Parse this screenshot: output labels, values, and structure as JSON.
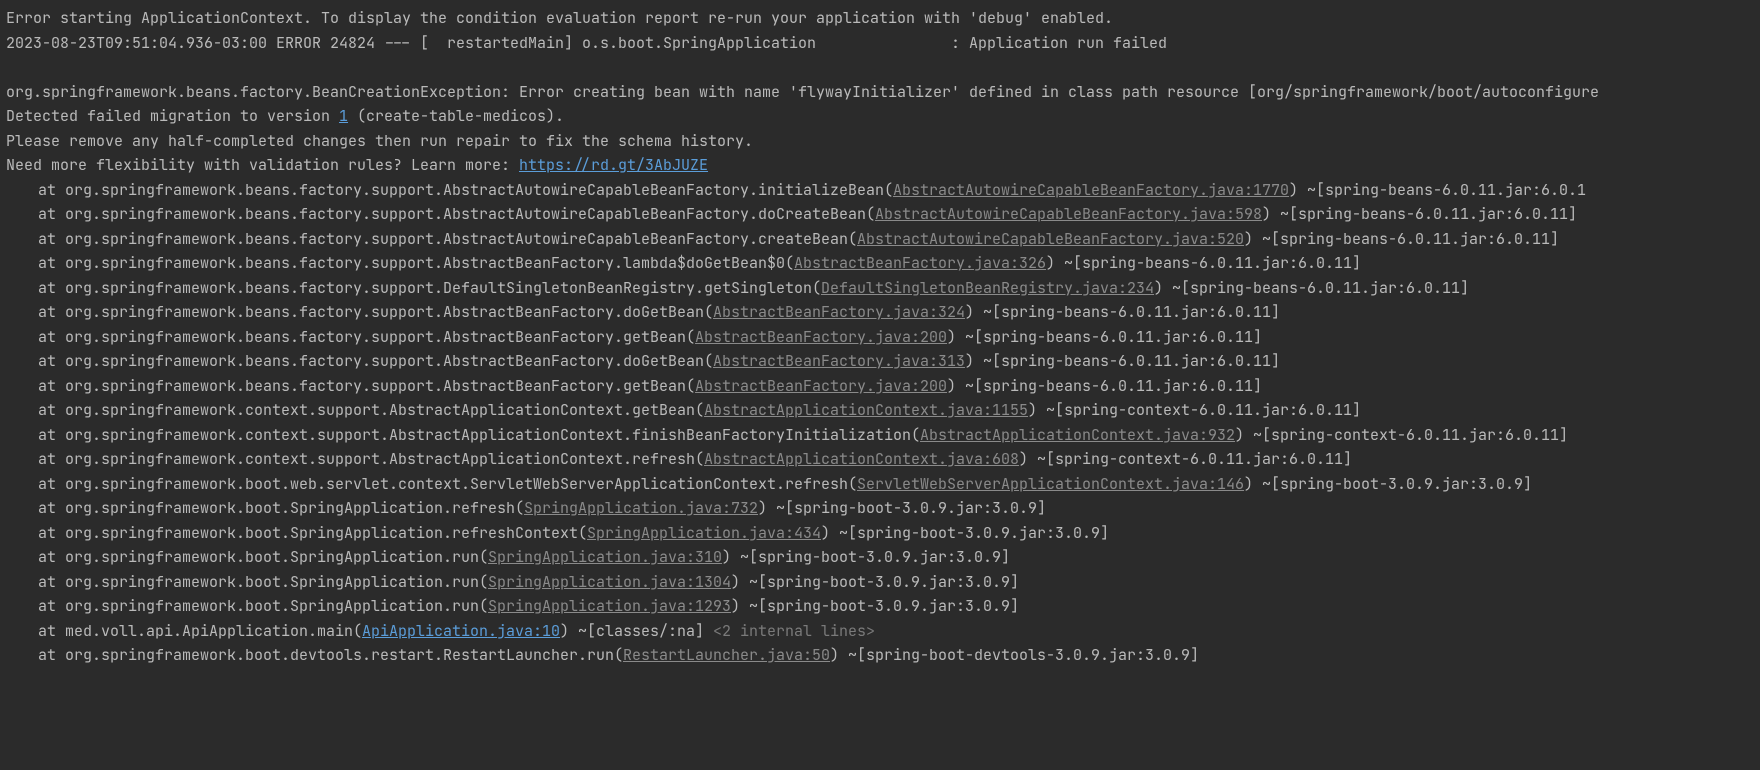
{
  "header": {
    "line1": "Error starting ApplicationContext. To display the condition evaluation report re-run your application with 'debug' enabled.",
    "line2": "2023-08-23T09:51:04.936-03:00 ERROR 24824 --- [  restartedMain] o.s.boot.SpringApplication               : Application run failed"
  },
  "exception": {
    "line": "org.springframework.beans.factory.BeanCreationException: Error creating bean with name 'flywayInitializer' defined in class path resource [org/springframework/boot/autoconfigure"
  },
  "migration": {
    "prefix": "Detected failed migration to version ",
    "link": "1",
    "suffix": " (create-table-medicos)."
  },
  "advice1": "Please remove any half-completed changes then run repair to fix the schema history.",
  "advice2_prefix": "Need more flexibility with validation rules? Learn more: ",
  "advice2_url": "https://rd.gt/3AbJUZE",
  "stack": [
    {
      "pre": "at org.springframework.beans.factory.support.AbstractAutowireCapableBeanFactory.initializeBean(",
      "src": "AbstractAutowireCapableBeanFactory.java:1770",
      "post": ") ~[spring-beans-6.0.11.jar:6.0.1"
    },
    {
      "pre": "at org.springframework.beans.factory.support.AbstractAutowireCapableBeanFactory.doCreateBean(",
      "src": "AbstractAutowireCapableBeanFactory.java:598",
      "post": ") ~[spring-beans-6.0.11.jar:6.0.11]"
    },
    {
      "pre": "at org.springframework.beans.factory.support.AbstractAutowireCapableBeanFactory.createBean(",
      "src": "AbstractAutowireCapableBeanFactory.java:520",
      "post": ") ~[spring-beans-6.0.11.jar:6.0.11]"
    },
    {
      "pre": "at org.springframework.beans.factory.support.AbstractBeanFactory.lambda$doGetBean$0(",
      "src": "AbstractBeanFactory.java:326",
      "post": ") ~[spring-beans-6.0.11.jar:6.0.11]"
    },
    {
      "pre": "at org.springframework.beans.factory.support.DefaultSingletonBeanRegistry.getSingleton(",
      "src": "DefaultSingletonBeanRegistry.java:234",
      "post": ") ~[spring-beans-6.0.11.jar:6.0.11]"
    },
    {
      "pre": "at org.springframework.beans.factory.support.AbstractBeanFactory.doGetBean(",
      "src": "AbstractBeanFactory.java:324",
      "post": ") ~[spring-beans-6.0.11.jar:6.0.11]"
    },
    {
      "pre": "at org.springframework.beans.factory.support.AbstractBeanFactory.getBean(",
      "src": "AbstractBeanFactory.java:200",
      "post": ") ~[spring-beans-6.0.11.jar:6.0.11]"
    },
    {
      "pre": "at org.springframework.beans.factory.support.AbstractBeanFactory.doGetBean(",
      "src": "AbstractBeanFactory.java:313",
      "post": ") ~[spring-beans-6.0.11.jar:6.0.11]"
    },
    {
      "pre": "at org.springframework.beans.factory.support.AbstractBeanFactory.getBean(",
      "src": "AbstractBeanFactory.java:200",
      "post": ") ~[spring-beans-6.0.11.jar:6.0.11]"
    },
    {
      "pre": "at org.springframework.context.support.AbstractApplicationContext.getBean(",
      "src": "AbstractApplicationContext.java:1155",
      "post": ") ~[spring-context-6.0.11.jar:6.0.11]"
    },
    {
      "pre": "at org.springframework.context.support.AbstractApplicationContext.finishBeanFactoryInitialization(",
      "src": "AbstractApplicationContext.java:932",
      "post": ") ~[spring-context-6.0.11.jar:6.0.11]"
    },
    {
      "pre": "at org.springframework.context.support.AbstractApplicationContext.refresh(",
      "src": "AbstractApplicationContext.java:608",
      "post": ") ~[spring-context-6.0.11.jar:6.0.11]"
    },
    {
      "pre": "at org.springframework.boot.web.servlet.context.ServletWebServerApplicationContext.refresh(",
      "src": "ServletWebServerApplicationContext.java:146",
      "post": ") ~[spring-boot-3.0.9.jar:3.0.9]"
    },
    {
      "pre": "at org.springframework.boot.SpringApplication.refresh(",
      "src": "SpringApplication.java:732",
      "post": ") ~[spring-boot-3.0.9.jar:3.0.9]"
    },
    {
      "pre": "at org.springframework.boot.SpringApplication.refreshContext(",
      "src": "SpringApplication.java:434",
      "post": ") ~[spring-boot-3.0.9.jar:3.0.9]"
    },
    {
      "pre": "at org.springframework.boot.SpringApplication.run(",
      "src": "SpringApplication.java:310",
      "post": ") ~[spring-boot-3.0.9.jar:3.0.9]"
    },
    {
      "pre": "at org.springframework.boot.SpringApplication.run(",
      "src": "SpringApplication.java:1304",
      "post": ") ~[spring-boot-3.0.9.jar:3.0.9]"
    },
    {
      "pre": "at org.springframework.boot.SpringApplication.run(",
      "src": "SpringApplication.java:1293",
      "post": ") ~[spring-boot-3.0.9.jar:3.0.9]"
    },
    {
      "pre": "at med.voll.api.ApiApplication.main(",
      "src": "ApiApplication.java:10",
      "post": ") ~[classes/:na] ",
      "note": "<2 internal lines>",
      "hl": true
    },
    {
      "pre": "at org.springframework.boot.devtools.restart.RestartLauncher.run(",
      "src": "RestartLauncher.java:50",
      "post": ") ~[spring-boot-devtools-3.0.9.jar:3.0.9]"
    }
  ]
}
